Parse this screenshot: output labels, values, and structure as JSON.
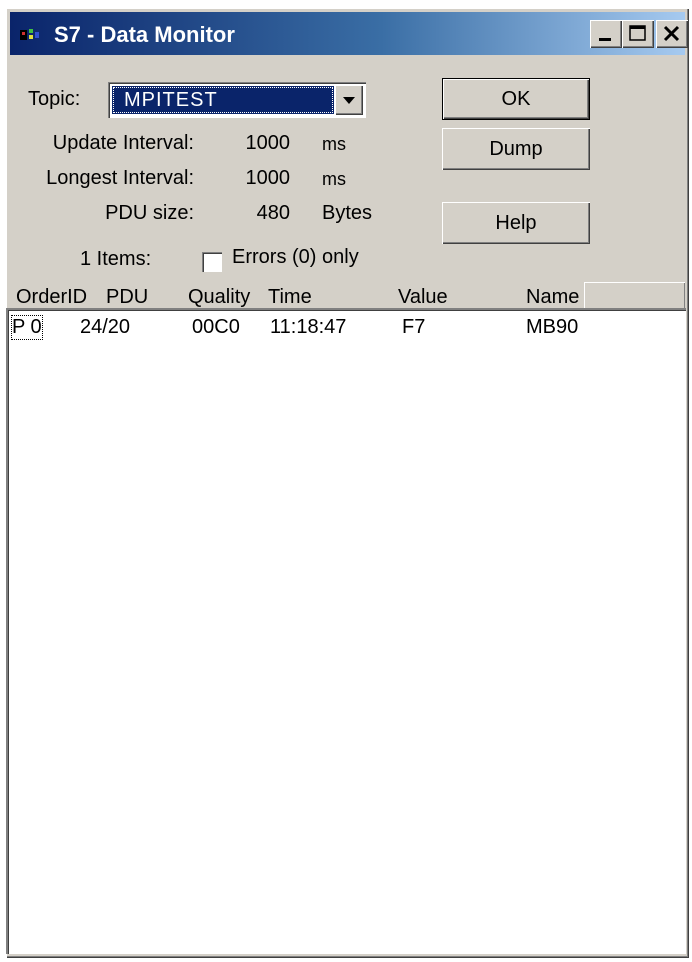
{
  "window": {
    "title": "S7 - Data Monitor",
    "title_colors": {
      "active_start": "#0a246a",
      "active_end": "#a6caf0"
    }
  },
  "topic": {
    "label": "Topic:",
    "value": "MPITEST"
  },
  "stats": {
    "update_interval": {
      "label": "Update Interval:",
      "value": "1000",
      "unit": "ms"
    },
    "longest_interval": {
      "label": "Longest Interval:",
      "value": "1000",
      "unit": "ms"
    },
    "pdu_size": {
      "label": "PDU size:",
      "value": "480",
      "unit": "Bytes"
    }
  },
  "items_count": "1 Items:",
  "errors_checkbox": {
    "label": "Errors (0) only",
    "checked": false
  },
  "buttons": {
    "ok": "OK",
    "dump": "Dump",
    "help": "Help"
  },
  "columns": [
    "OrderID",
    "PDU",
    "Quality",
    "Time",
    "Value",
    "Name"
  ],
  "rows": [
    {
      "orderid": "P 0",
      "pdu": "24/20",
      "quality": "00C0",
      "time": "11:18:47",
      "value": "F7",
      "name": "MB90"
    }
  ],
  "icons": [
    "app-icon",
    "minimize-icon",
    "maximize-icon",
    "close-icon",
    "dropdown-arrow-icon"
  ]
}
